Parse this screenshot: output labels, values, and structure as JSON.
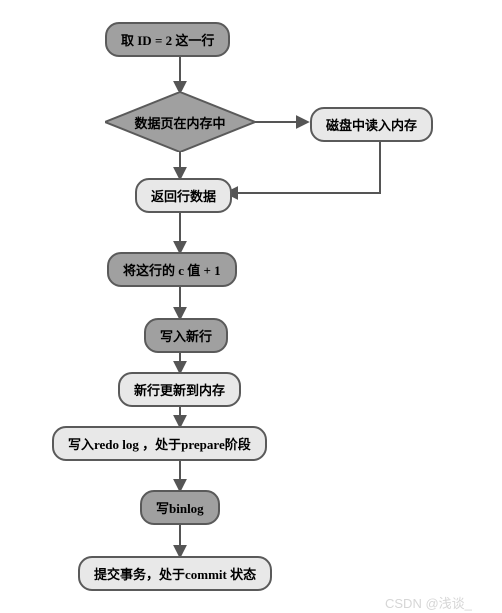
{
  "nodes": {
    "n1": "取 ID = 2 这一行",
    "n2": "数据页在内存中",
    "n3": "磁盘中读入内存",
    "n4": "返回行数据",
    "n5": "将这行的 c 值 + 1",
    "n6": "写入新行",
    "n7": "新行更新到内存",
    "n8": "写入redo log ，处于prepare阶段",
    "n9": "写binlog",
    "n10": "提交事务，处于commit 状态"
  },
  "watermark": "CSDN @浅谈_"
}
